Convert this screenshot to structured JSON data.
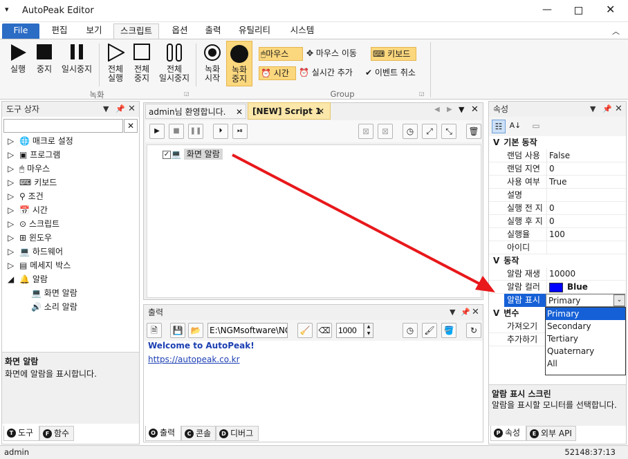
{
  "window": {
    "title": "AutoPeak Editor"
  },
  "menu": [
    "File",
    "편집",
    "보기",
    "스크립트",
    "옵션",
    "출력",
    "유틸리티",
    "시스템"
  ],
  "ribbon": {
    "group1": {
      "name": "녹화",
      "buttons": [
        "실행",
        "중지",
        "일시중지",
        "전체\n실행",
        "전체\n중지",
        "전체\n일시중지",
        "녹화\n시작",
        "녹화\n중지"
      ]
    },
    "group2": {
      "name": "Group",
      "row1": [
        "마우스",
        "마우스 이동",
        "키보드"
      ],
      "row2": [
        "시간",
        "실시간 추가",
        "이벤트 취소"
      ]
    }
  },
  "toolbox": {
    "title": "도구 상자",
    "search_value": "",
    "items": [
      "매크로 설정",
      "프로그램",
      "마우스",
      "키보드",
      "조건",
      "시간",
      "스크립트",
      "윈도우",
      "하드웨어",
      "메세지 박스",
      "알람"
    ],
    "alarm_children": [
      "화면 알람",
      "소리 알람"
    ],
    "desc_title": "화면 알람",
    "desc_text": "화면에 알람을 표시합니다.",
    "tabs": [
      "도구",
      "함수"
    ]
  },
  "editor": {
    "tabs": [
      "admin님 환영합니다.",
      "[NEW] Script 1"
    ],
    "node_label": "화면 알람"
  },
  "output": {
    "title": "출력",
    "path": "E:\\NGMsoftware\\NG",
    "interval": "1000",
    "line1": "Welcome to AutoPeak!",
    "line2": "https://autopeak.co.kr",
    "tabs": [
      "출력",
      "콘솔",
      "디버그"
    ]
  },
  "properties": {
    "title": "속성",
    "cat1": "기본 동작",
    "rows1": [
      [
        "랜덤 사용",
        "False"
      ],
      [
        "랜덤 지연",
        "0"
      ],
      [
        "사용 여부",
        "True"
      ],
      [
        "설명",
        ""
      ],
      [
        "실행 전 지",
        "0"
      ],
      [
        "실행 후 지",
        "0"
      ],
      [
        "실행율",
        "100"
      ],
      [
        "아이디",
        ""
      ]
    ],
    "cat2": "동작",
    "rows2": [
      [
        "알람 재생",
        "10000"
      ],
      [
        "알람 컬러",
        "Blue"
      ],
      [
        "알람 표시",
        "Primary"
      ]
    ],
    "cat3": "변수",
    "rows3": [
      [
        "가져오기",
        ""
      ],
      [
        "추가하기",
        ""
      ]
    ],
    "dropdown": [
      "Primary",
      "Secondary",
      "Tertiary",
      "Quaternary",
      "All"
    ],
    "desc_title": "알람 표시 스크린",
    "desc_text": "알람을 표시할 모니터를 선택합니다.",
    "tabs": [
      "속성",
      "외부 API"
    ],
    "alarm_color_hex": "#0000ff"
  },
  "status": {
    "user": "admin",
    "time": "52148:37:13"
  },
  "colors": {
    "accent": "#2b6cc5",
    "highlight": "#fbd77d",
    "arrow": "#e8181b",
    "selected": "#1560d6"
  }
}
